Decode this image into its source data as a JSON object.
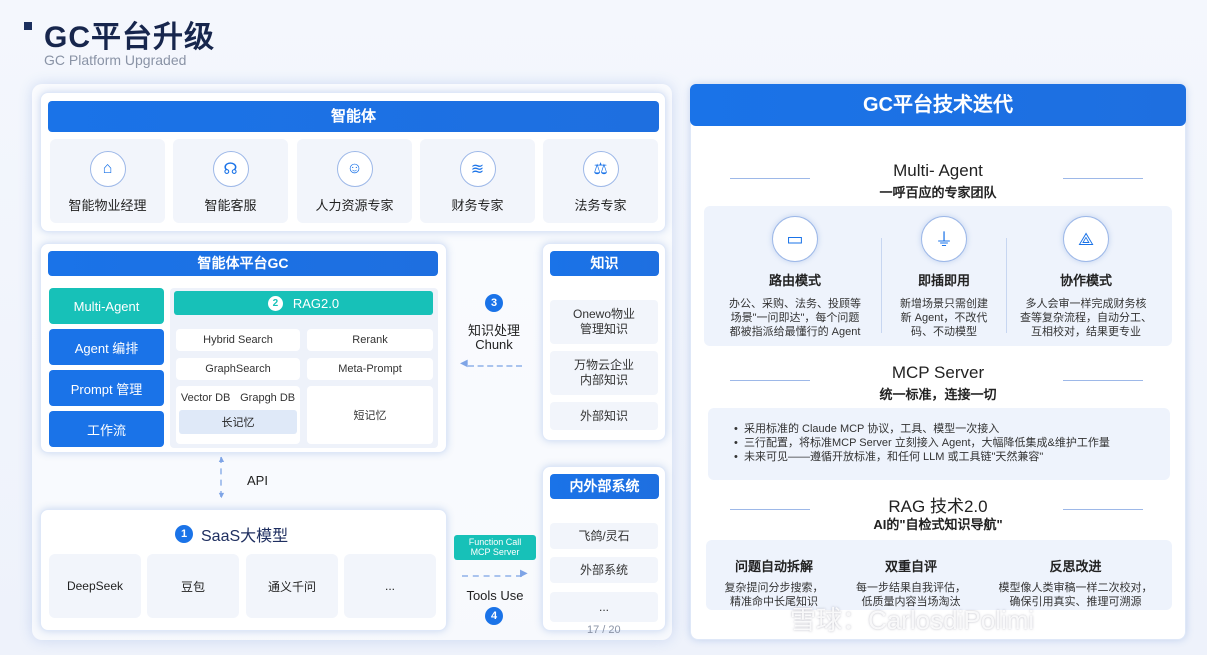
{
  "header": {
    "title": "GC平台升级",
    "subtitle": "GC Platform Upgraded"
  },
  "agents": {
    "title": "智能体",
    "items": [
      {
        "label": "智能物业经理",
        "icon": "house-gear-icon"
      },
      {
        "label": "智能客服",
        "icon": "headset-icon"
      },
      {
        "label": "人力资源专家",
        "icon": "person-icon"
      },
      {
        "label": "财务专家",
        "icon": "coins-icon"
      },
      {
        "label": "法务专家",
        "icon": "scales-icon"
      }
    ]
  },
  "platform": {
    "title": "智能体平台GC",
    "side_items": [
      "Multi-Agent",
      "Agent 编排",
      "Prompt 管理",
      "工作流"
    ],
    "rag": {
      "number": "2",
      "title": "RAG2.0",
      "cells": [
        "Hybrid Search",
        "Rerank",
        "GraphSearch",
        "Meta-Prompt",
        "Vector DB",
        "Grapgh DB",
        "长记忆",
        "短记忆"
      ]
    }
  },
  "chunk": {
    "number": "3",
    "line1": "知识处理",
    "line2": "Chunk"
  },
  "knowledge": {
    "title": "知识",
    "items": [
      "Onewo物业\n管理知识",
      "万物云企业\n内部知识",
      "外部知识"
    ]
  },
  "api": {
    "label": "API"
  },
  "saas": {
    "number": "1",
    "title": "SaaS大模型",
    "items": [
      "DeepSeek",
      "豆包",
      "通义千问",
      "..."
    ]
  },
  "tools": {
    "badge_line1": "Function Call",
    "badge_line2": "MCP Server",
    "label": "Tools Use",
    "number": "4"
  },
  "systems": {
    "title": "内外部系统",
    "items": [
      "飞鸽/灵石",
      "外部系统",
      "..."
    ]
  },
  "page_number": "17 / 20",
  "right": {
    "title": "GC平台技术迭代",
    "multi_agent": {
      "title": "Multi- Agent",
      "subtitle": "一呼百应的专家团队",
      "features": [
        {
          "title": "路由模式",
          "desc": "办公、采购、法务、投顾等\n场景\"一问即达\"，每个问题\n都被指派给最懂行的 Agent",
          "icon": "router-icon"
        },
        {
          "title": "即插即用",
          "desc": "新增场景只需创建\n新 Agent，不改代\n码、不动模型",
          "icon": "plug-icon"
        },
        {
          "title": "协作模式",
          "desc": "多人会审一样完成财务核\n查等复杂流程，自动分工、\n互相校对，结果更专业",
          "icon": "collab-icon"
        }
      ]
    },
    "mcp": {
      "title": "MCP Server",
      "subtitle": "统一标准，连接一切",
      "bullets": [
        "采用标准的 Claude MCP 协议，工具、模型一次接入",
        "三行配置，将标准MCP Server 立刻接入 Agent，大幅降低集成&维护工作量",
        "未来可见——遵循开放标准，和任何 LLM 或工具链\"天然兼容\""
      ]
    },
    "rag": {
      "title": "RAG 技术2.0",
      "subtitle": "AI的\"自检式知识导航\"",
      "features": [
        {
          "title": "问题自动拆解",
          "desc": "复杂提问分步搜索，\n精准命中长尾知识"
        },
        {
          "title": "双重自评",
          "desc": "每一步结果自我评估，\n低质量内容当场淘汰"
        },
        {
          "title": "反思改进",
          "desc": "模型像人类审稿一样二次校对，\n确保引用真实、推理可溯源"
        }
      ]
    }
  },
  "watermark": "雪球：CarlosdiPolimi",
  "colors": {
    "primary": "#1a73e8",
    "teal": "#17c1b8",
    "title": "#17264d"
  }
}
